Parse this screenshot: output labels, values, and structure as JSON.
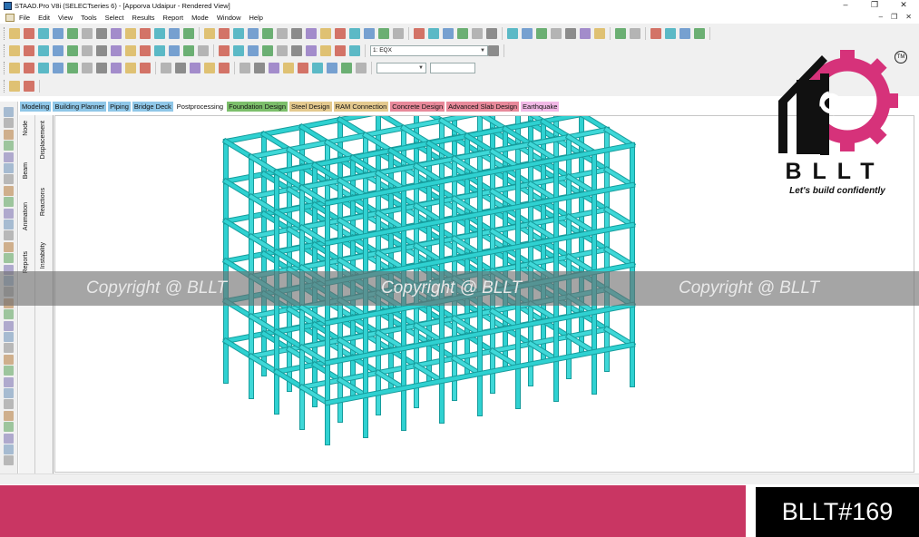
{
  "window": {
    "title": "STAAD.Pro V8i (SELECTseries 6) - [Apporva Udaipur - Rendered View]",
    "controls": [
      "–",
      "❐",
      "✕"
    ]
  },
  "menu": {
    "items": [
      "File",
      "Edit",
      "View",
      "Tools",
      "Select",
      "Results",
      "Report",
      "Mode",
      "Window",
      "Help"
    ],
    "mdi_controls": [
      "–",
      "❐",
      "✕"
    ]
  },
  "toolbar": {
    "load_case": "1: EQX"
  },
  "page_tabs": [
    {
      "label": "Modeling",
      "color": "#8fc7e8"
    },
    {
      "label": "Building Planner",
      "color": "#8fc7e8"
    },
    {
      "label": "Piping",
      "color": "#8fc7e8"
    },
    {
      "label": "Bridge Deck",
      "color": "#8fc7e8"
    },
    {
      "label": "Postprocessing",
      "color": "#ffffff"
    },
    {
      "label": "Foundation Design",
      "color": "#7cbf6b"
    },
    {
      "label": "Steel Design",
      "color": "#e4c98e"
    },
    {
      "label": "RAM Connection",
      "color": "#e4c98e"
    },
    {
      "label": "Concrete Design",
      "color": "#e8899a"
    },
    {
      "label": "Advanced Slab Design",
      "color": "#e8899a"
    },
    {
      "label": "Earthquake",
      "color": "#f1b8e6"
    }
  ],
  "side_tabs_outer": [
    "Node",
    "Beam",
    "Animation",
    "Reports"
  ],
  "side_tabs_inner": [
    "Displacement",
    "Reactions",
    "Instability"
  ],
  "watermark": [
    "Copyright @ BLLT",
    "Copyright @ BLLT",
    "Copyright @ BLLT"
  ],
  "logo": {
    "name": "BLLT",
    "tagline": "Let's build confidently",
    "tm": "TM",
    "colors": {
      "house": "#111111",
      "gear": "#d6327a"
    }
  },
  "footer": {
    "badge": "BLLT#169",
    "band_color": "#c93663"
  },
  "model": {
    "frame_color": "#2fd1d1"
  }
}
